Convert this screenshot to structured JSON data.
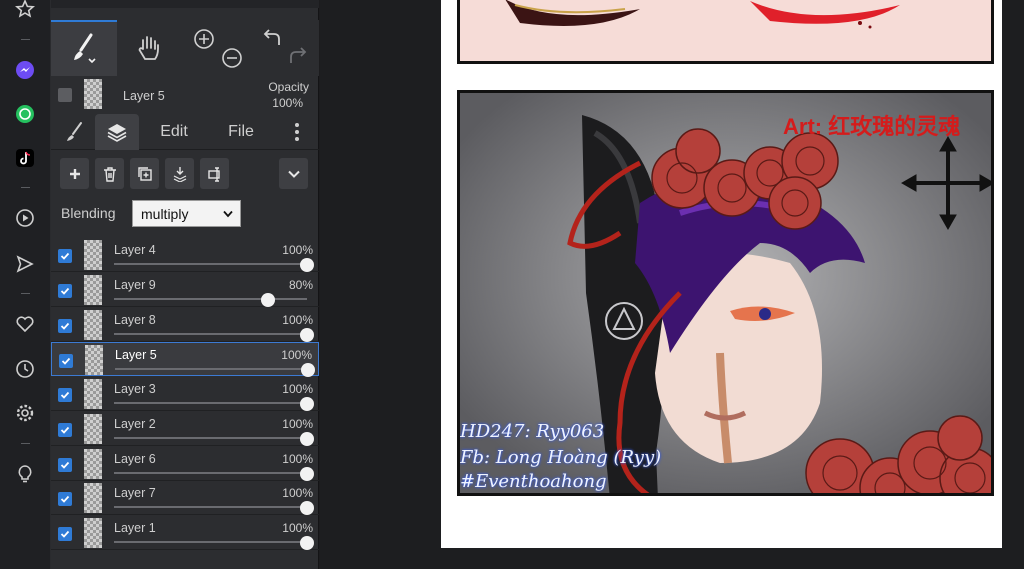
{
  "panel": {
    "current_layer": "Layer 5",
    "opacity_label": "Opacity",
    "opacity_value": "100%",
    "tabs": {
      "edit": "Edit",
      "file": "File"
    },
    "blending_label": "Blending",
    "blending_value": "multiply",
    "layers": [
      {
        "name": "Layer 4",
        "opacity": "100%",
        "level": 1.0
      },
      {
        "name": "Layer 9",
        "opacity": "80%",
        "level": 0.8
      },
      {
        "name": "Layer 8",
        "opacity": "100%",
        "level": 1.0
      },
      {
        "name": "Layer 5",
        "opacity": "100%",
        "level": 1.0,
        "active": true
      },
      {
        "name": "Layer 3",
        "opacity": "100%",
        "level": 1.0
      },
      {
        "name": "Layer 2",
        "opacity": "100%",
        "level": 1.0
      },
      {
        "name": "Layer 6",
        "opacity": "100%",
        "level": 1.0
      },
      {
        "name": "Layer 7",
        "opacity": "100%",
        "level": 1.0
      },
      {
        "name": "Layer 1",
        "opacity": "100%",
        "level": 1.0
      }
    ]
  },
  "canvas": {
    "art_credit": "Art: 红玫瑰的灵魂",
    "credits": [
      "HD247: Ryy063",
      "Fb: Long Hoàng (Ryy)",
      "#Eventhoahong"
    ]
  },
  "colors": {
    "accent": "#2f7bd6",
    "art_red": "#d41c1c",
    "rose": "#b5403a"
  },
  "icons": [
    "star-icon",
    "messenger-icon",
    "whatsapp-icon",
    "tiktok-icon",
    "play-circle-icon",
    "send-icon",
    "heart-icon",
    "clock-icon",
    "gear-icon",
    "lightbulb-icon",
    "brush-icon",
    "hand-icon",
    "zoom-in-icon",
    "zoom-out-icon",
    "undo-icon",
    "redo-icon",
    "layers-icon",
    "more-icon",
    "add-layer-icon",
    "delete-icon",
    "duplicate-icon",
    "merge-down-icon",
    "transform-icon",
    "chevron-down-icon"
  ]
}
